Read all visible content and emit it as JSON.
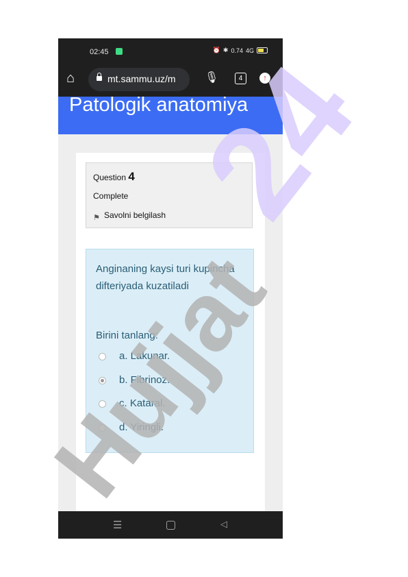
{
  "status_bar": {
    "time": "02:45",
    "network_speed": "0.74",
    "signal": "4G"
  },
  "browser": {
    "url": "mt.sammu.uz/m",
    "tab_count": "4"
  },
  "course": {
    "title": "Patologik anatomiya"
  },
  "question": {
    "label": "Question",
    "number": "4",
    "state": "Complete",
    "flag_label": "Savolni belgilash",
    "text": "Anginaning kaysi turi kupincha difteriyada kuzatiladi",
    "prompt": "Birini tanlang:",
    "options": [
      {
        "label": "a. Lakunar.",
        "selected": false
      },
      {
        "label": "b. Fibrinoz.",
        "selected": true
      },
      {
        "label": "c. Kataral.",
        "selected": false
      },
      {
        "label": "d. Yiringli.",
        "selected": false
      }
    ]
  },
  "watermark": {
    "text_gray": "Hujjat",
    "text_purple": "24",
    "gray_color": "#b3b3b3",
    "purple_color": "#d9cdfd"
  },
  "colors": {
    "banner": "#3b6cf3",
    "question_box": "#dbeef7",
    "question_text": "#2a5d76"
  }
}
